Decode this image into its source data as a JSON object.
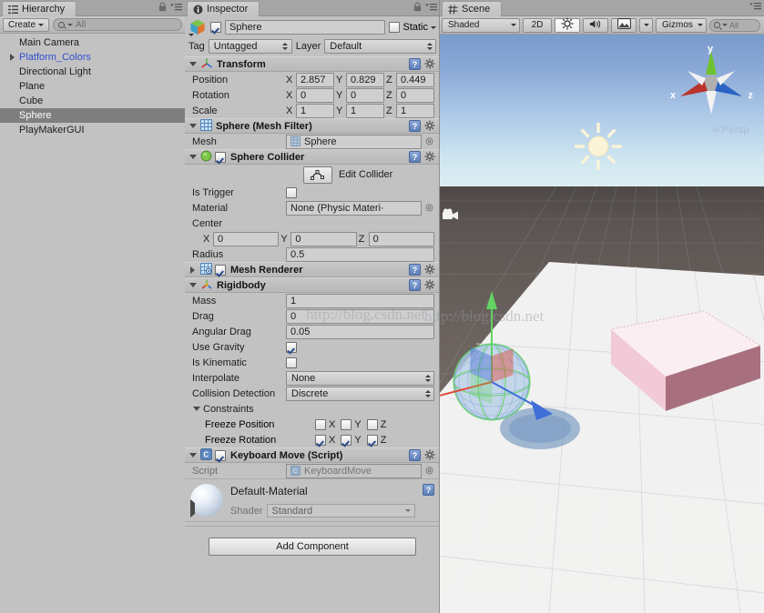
{
  "hierarchy": {
    "tab_label": "Hierarchy",
    "tab_icon": "hierarchy-icon",
    "create_label": "Create",
    "search_placeholder": "All",
    "items": [
      {
        "name": "Main Camera",
        "expandable": false,
        "prefab": false,
        "selected": false
      },
      {
        "name": "Platform_Colors",
        "expandable": true,
        "prefab": true,
        "selected": false
      },
      {
        "name": "Directional Light",
        "expandable": false,
        "prefab": false,
        "selected": false
      },
      {
        "name": "Plane",
        "expandable": false,
        "prefab": false,
        "selected": false
      },
      {
        "name": "Cube",
        "expandable": false,
        "prefab": false,
        "selected": false
      },
      {
        "name": "Sphere",
        "expandable": false,
        "prefab": false,
        "selected": true
      },
      {
        "name": "PlayMakerGUI",
        "expandable": false,
        "prefab": false,
        "selected": false
      }
    ]
  },
  "inspector": {
    "tab_label": "Inspector",
    "tab_icon": "info-icon",
    "gameobject": {
      "name": "Sphere",
      "enabled": true,
      "static_label": "Static",
      "static_checked": false,
      "tag_label": "Tag",
      "tag_value": "Untagged",
      "layer_label": "Layer",
      "layer_value": "Default"
    },
    "transform": {
      "title": "Transform",
      "position_label": "Position",
      "rotation_label": "Rotation",
      "scale_label": "Scale",
      "axes": [
        "X",
        "Y",
        "Z"
      ],
      "position": [
        "2.857",
        "0.829",
        "0.449"
      ],
      "rotation": [
        "0",
        "0",
        "0"
      ],
      "scale": [
        "1",
        "1",
        "1"
      ]
    },
    "mesh_filter": {
      "title": "Sphere (Mesh Filter)",
      "mesh_label": "Mesh",
      "mesh_value": "Sphere"
    },
    "sphere_collider": {
      "title": "Sphere Collider",
      "enabled": true,
      "edit_collider_label": "Edit Collider",
      "is_trigger_label": "Is Trigger",
      "is_trigger_checked": false,
      "material_label": "Material",
      "material_value": "None (Physic Materi·",
      "center_label": "Center",
      "center": [
        "0",
        "0",
        "0"
      ],
      "radius_label": "Radius",
      "radius_value": "0.5"
    },
    "mesh_renderer": {
      "title": "Mesh Renderer",
      "enabled": true,
      "collapsed": true
    },
    "rigidbody": {
      "title": "Rigidbody",
      "mass_label": "Mass",
      "mass_value": "1",
      "drag_label": "Drag",
      "drag_value": "0",
      "angular_drag_label": "Angular Drag",
      "angular_drag_value": "0.05",
      "use_gravity_label": "Use Gravity",
      "use_gravity_checked": true,
      "is_kinematic_label": "Is Kinematic",
      "is_kinematic_checked": false,
      "interpolate_label": "Interpolate",
      "interpolate_value": "None",
      "collision_detection_label": "Collision Detection",
      "collision_detection_value": "Discrete",
      "constraints_label": "Constraints",
      "freeze_position_label": "Freeze Position",
      "freeze_position": {
        "x": false,
        "y": false,
        "z": false
      },
      "freeze_rotation_label": "Freeze Rotation",
      "freeze_rotation": {
        "x": true,
        "y": true,
        "z": true
      },
      "axis_labels": [
        "X",
        "Y",
        "Z"
      ]
    },
    "script_component": {
      "title": "Keyboard Move (Script)",
      "enabled": true,
      "script_label": "Script",
      "script_value": "KeyboardMove"
    },
    "material": {
      "name": "Default-Material",
      "shader_label": "Shader",
      "shader_value": "Standard"
    },
    "add_component_label": "Add Component"
  },
  "scene": {
    "tab_label": "Scene",
    "tab_icon": "scene-grid-icon",
    "toolbar": {
      "draw_mode": "Shaded",
      "mode_2d": "2D",
      "lighting_icon": "sun-toggle-icon",
      "audio_icon": "speaker-icon",
      "effects_icon": "image-effects-icon",
      "gizmos_label": "Gizmos",
      "search_placeholder": "All"
    },
    "gizmo": {
      "x_label": "x",
      "y_label": "y",
      "z_label": "z",
      "projection_label": "Persp",
      "x_color": "#c1372f",
      "y_color": "#76c23a",
      "z_color": "#2f6fd0"
    },
    "objects": {
      "light_gizmo": "directional-light-sun-gizmo",
      "camera_gizmo": "camera-gizmo"
    },
    "watermark_text": "http://blog.csdn.net"
  }
}
